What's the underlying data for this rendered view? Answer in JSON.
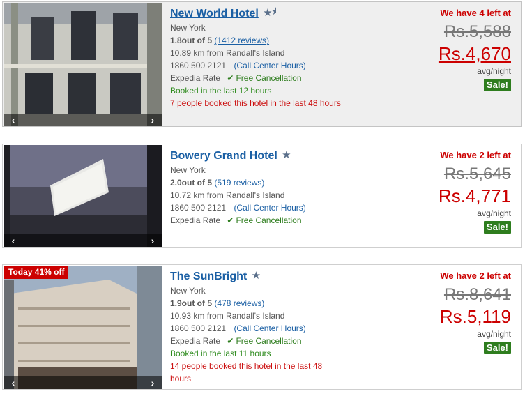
{
  "hotels": [
    {
      "name": "New World Hotel",
      "stars": "1.5",
      "city": "New York",
      "rating": "1.8out of 5",
      "reviews": "(1412 reviews)",
      "distance": "10.89 km from Randall's Island",
      "phone": "1860 500 2121",
      "call_center": "(Call Center Hours)",
      "rate_type": "Expedia Rate",
      "free_cancel": "Free Cancellation",
      "booked": "Booked in the last 12 hours",
      "people": "7 people booked this hotel in the last 48 hours",
      "left": "We have 4 left at",
      "old_price": "Rs.5,588",
      "new_price": "Rs.4,670",
      "avg": "avg/night",
      "sale": "Sale!"
    },
    {
      "name": "Bowery Grand Hotel",
      "stars": "1",
      "city": "New York",
      "rating": "2.0out of 5",
      "reviews": "(519 reviews)",
      "distance": "10.72 km from Randall's Island",
      "phone": "1860 500 2121",
      "call_center": "(Call Center Hours)",
      "rate_type": "Expedia Rate",
      "free_cancel": "Free Cancellation",
      "left": "We have 2 left at",
      "old_price": "Rs.5,645",
      "new_price": "Rs.4,771",
      "avg": "avg/night",
      "sale": "Sale!"
    },
    {
      "name": "The SunBright",
      "stars": "1",
      "deal": "Today 41% off",
      "city": "New York",
      "rating": "1.9out of 5",
      "reviews": "(478 reviews)",
      "distance": "10.93 km from Randall's Island",
      "phone": "1860 500 2121",
      "call_center": "(Call Center Hours)",
      "rate_type": "Expedia Rate",
      "free_cancel": "Free Cancellation",
      "booked": "Booked in the last 11 hours",
      "people": "14 people booked this hotel in the last 48 hours",
      "left": "We have 2 left at",
      "old_price": "Rs.8,641",
      "new_price": "Rs.5,119",
      "avg": "avg/night",
      "sale": "Sale!"
    }
  ],
  "colors": {
    "link": "#1a5fa4",
    "price_red": "#cc0000",
    "sale_green": "#2e7d1e",
    "highlight_bg": "#efefef"
  },
  "icons": {
    "star": "star-icon",
    "check": "checkmark-icon",
    "prev": "chevron-left-icon",
    "next": "chevron-right-icon"
  }
}
